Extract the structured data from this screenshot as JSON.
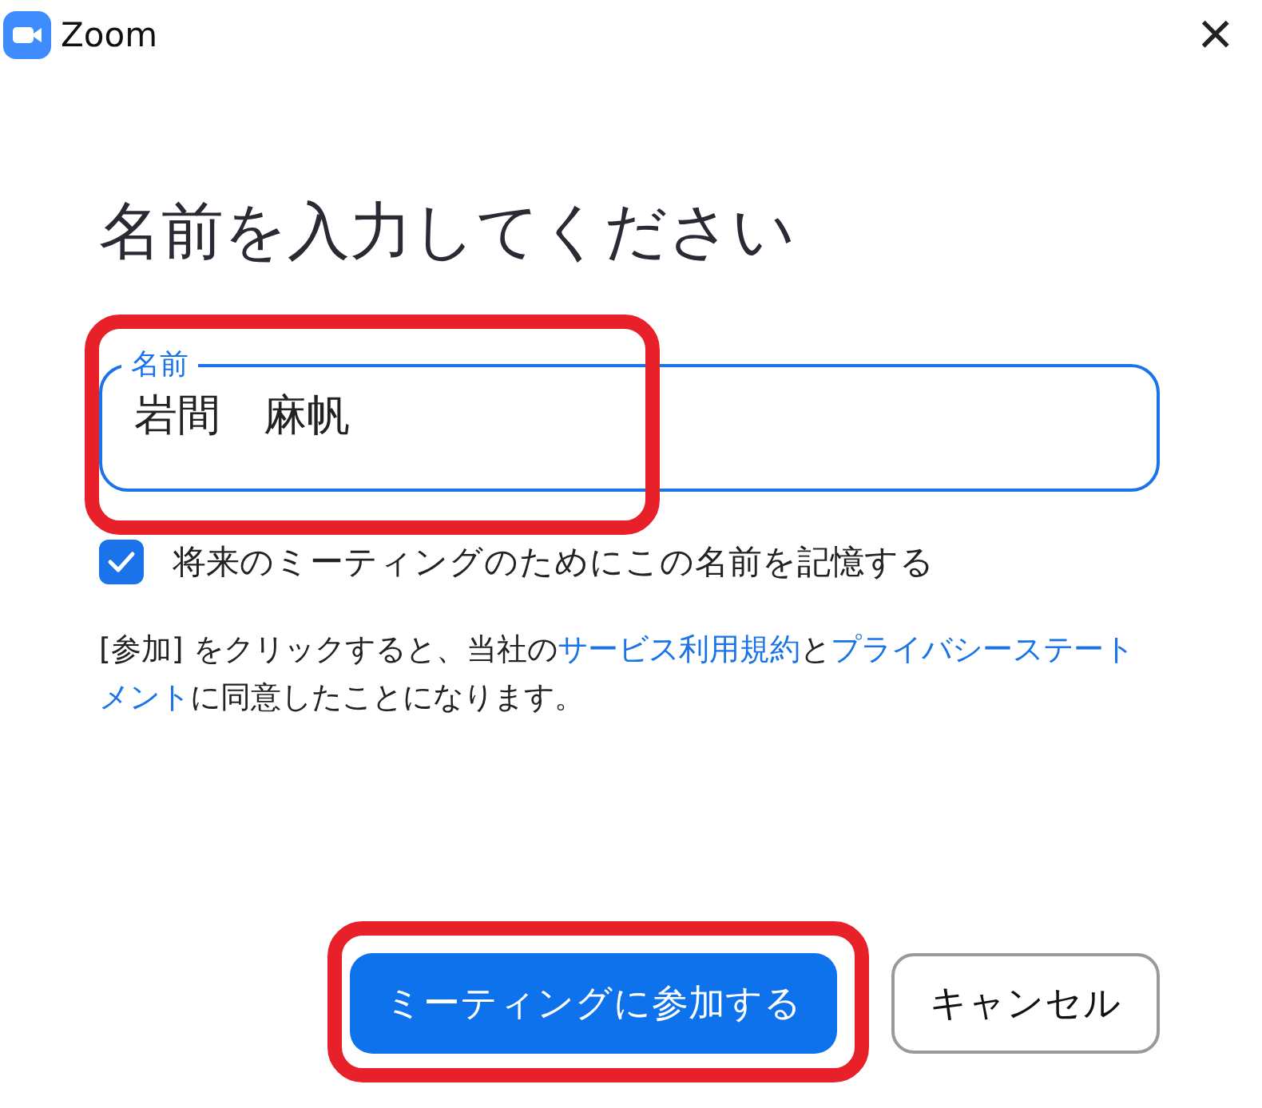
{
  "window": {
    "title": "Zoom",
    "close": "×"
  },
  "heading": "名前を入力してください",
  "name_field": {
    "label": "名前",
    "value": "岩間　麻帆",
    "highlighted": true
  },
  "remember": {
    "label": "将来のミーティングのためにこの名前を記憶する",
    "checked": true
  },
  "notice": [
    {
      "kind": "text",
      "text": "[参加] をクリックすると、当社の"
    },
    {
      "kind": "link",
      "text": "サービス利用規約"
    },
    {
      "kind": "text",
      "text": "と"
    },
    {
      "kind": "link",
      "text": "プライバシーステートメント"
    },
    {
      "kind": "text",
      "text": "に同意したことになります。"
    }
  ],
  "buttons": [
    {
      "kind": "primary",
      "label": "ミーティングに参加する",
      "highlighted": true
    },
    {
      "kind": "secondary",
      "label": "キャンセル"
    }
  ]
}
